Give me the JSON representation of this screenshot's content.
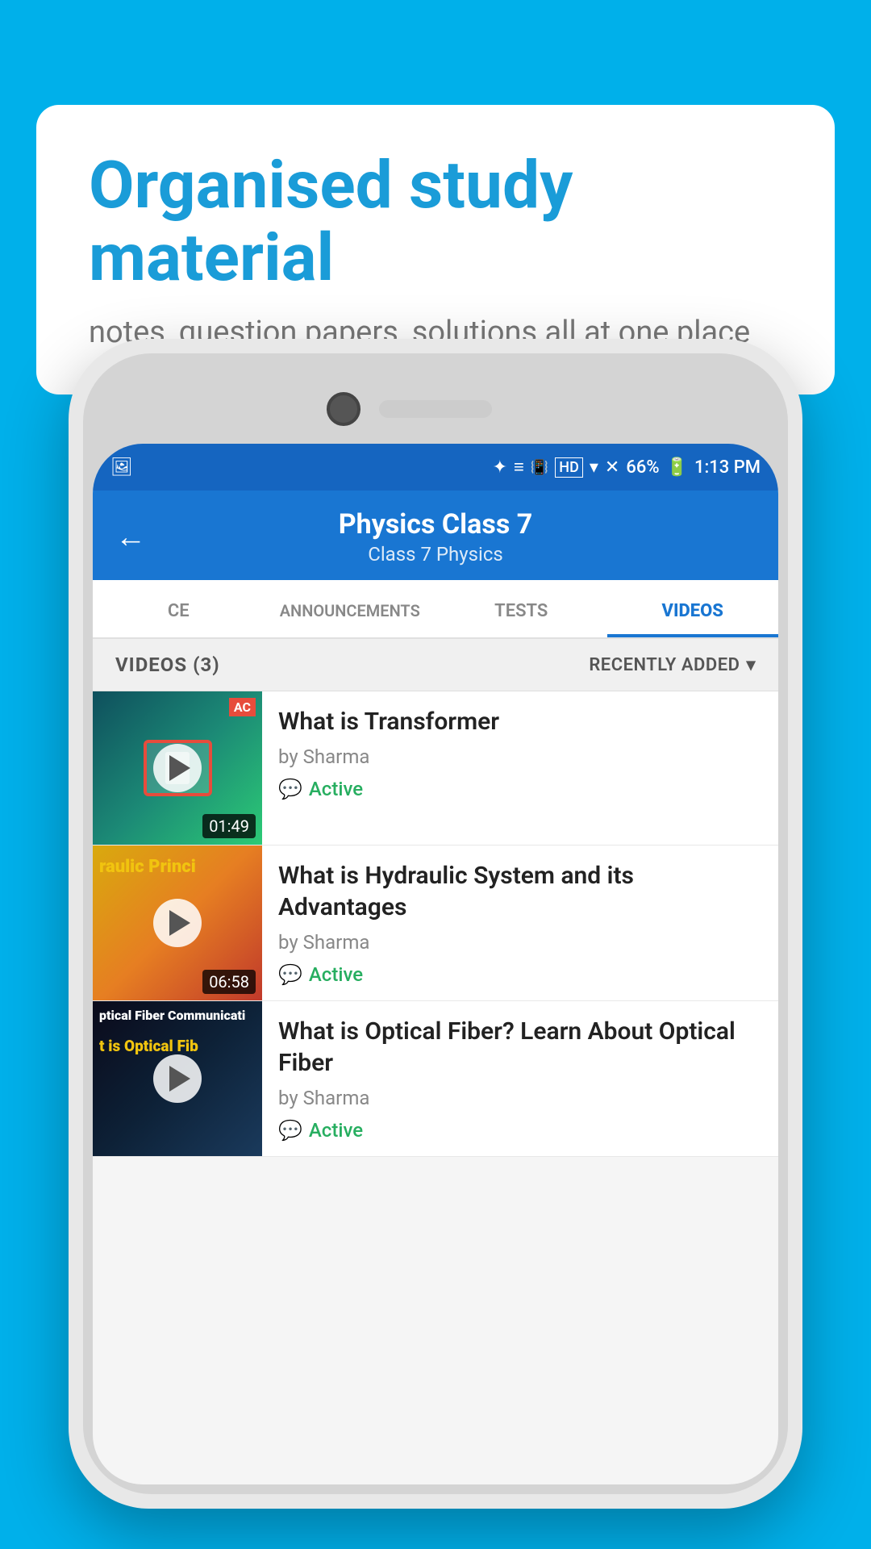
{
  "page": {
    "background_color": "#00b0ea"
  },
  "speech_bubble": {
    "title": "Organised study material",
    "subtitle": "notes, question papers, solutions all at one place"
  },
  "app_bar": {
    "back_label": "←",
    "title": "Physics Class 7",
    "subtitle": "Class 7   Physics"
  },
  "tabs": [
    {
      "id": "ce",
      "label": "CE",
      "active": false
    },
    {
      "id": "announcements",
      "label": "ANNOUNCEMENTS",
      "active": false
    },
    {
      "id": "tests",
      "label": "TESTS",
      "active": false
    },
    {
      "id": "videos",
      "label": "VIDEOS",
      "active": true
    }
  ],
  "filter_bar": {
    "count_label": "VIDEOS (3)",
    "sort_label": "RECENTLY ADDED",
    "sort_icon": "▾"
  },
  "status_bar": {
    "battery": "66%",
    "time": "1:13 PM",
    "signal_icons": "🔵 ≡ ✦ HD ▾ ✕ ✕ 66%"
  },
  "videos": [
    {
      "id": "video-1",
      "title": "What is  Transformer",
      "by": "by Sharma",
      "status": "Active",
      "duration": "01:49",
      "thumb_label": "AC",
      "thumb_color": "teal"
    },
    {
      "id": "video-2",
      "title": "What is Hydraulic System and its Advantages",
      "by": "by Sharma",
      "status": "Active",
      "duration": "06:58",
      "thumb_text_line1": "raulic Princi",
      "thumb_color": "yellow"
    },
    {
      "id": "video-3",
      "title": "What is Optical Fiber? Learn About Optical Fiber",
      "by": "by Sharma",
      "status": "Active",
      "duration": "",
      "thumb_text_line1": "ptical Fiber Communicati",
      "thumb_text_line2": "t is Optical Fib",
      "thumb_color": "dark"
    }
  ]
}
